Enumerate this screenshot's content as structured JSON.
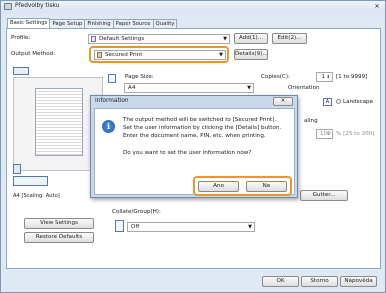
{
  "window": {
    "title": "Předvolby tisku"
  },
  "tabs": [
    "Basic Settings",
    "Page Setup",
    "Finishing",
    "Paper Source",
    "Quality"
  ],
  "profile": {
    "label": "Profile:",
    "value": "Default Settings",
    "add": "Add(1)...",
    "edit": "Edit(2)..."
  },
  "output": {
    "label": "Output Method:",
    "value": "Secured Print",
    "details": "Details(9)..."
  },
  "page_size": {
    "label": "Page Size:",
    "value": "A4"
  },
  "copies": {
    "label": "Copies(C):",
    "value": "1",
    "range": "[1 to 9999]"
  },
  "orientation": {
    "label": "Orientation",
    "landscape": "Landscape"
  },
  "scaling": {
    "label": "aling",
    "value": "100",
    "range": "% [25 to 200]"
  },
  "preview": {
    "caption": "A4 [Scaling: Auto]"
  },
  "gutter": "Gutter...",
  "collate": {
    "label": "Collate/Group(H):",
    "value": "Off"
  },
  "left_buttons": {
    "view": "View Settings",
    "restore": "Restore Defaults"
  },
  "footer": {
    "ok": "OK",
    "cancel": "Storno",
    "help": "Nápověda"
  },
  "dialog": {
    "title": "Information",
    "lines": [
      "The output method will be switched to [Secured Print].",
      "Set the user information by clicking the [Details] button.",
      "Enter the document name, PIN, etc. when printing.",
      "Do you want to set the user information now?"
    ],
    "yes": "Ano",
    "no": "Ne"
  }
}
